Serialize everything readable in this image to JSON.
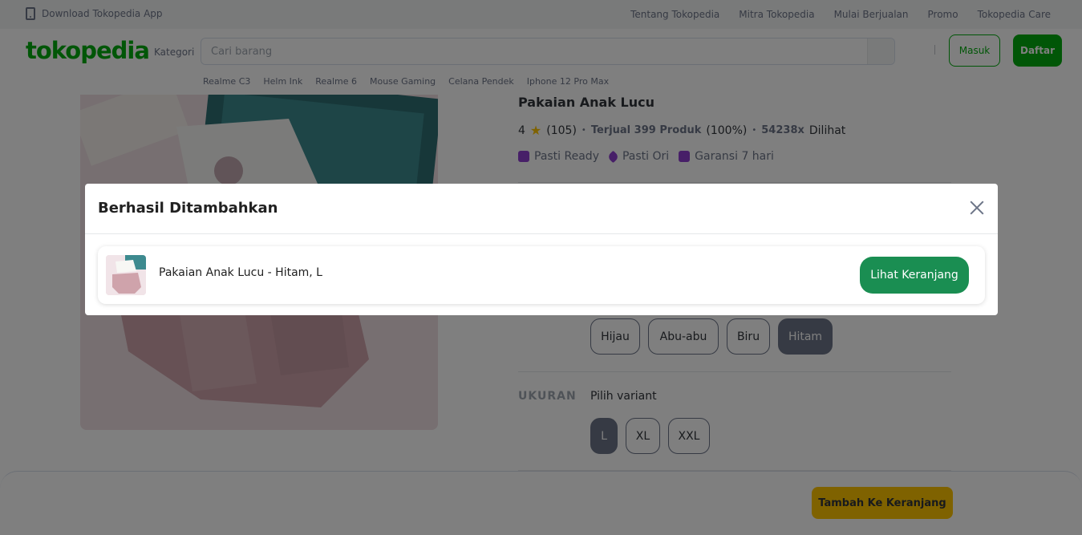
{
  "topbar": {
    "app_link": "Download Tokopedia App",
    "links": [
      "Tentang Tokopedia",
      "Mitra Tokopedia",
      "Mulai Berjualan",
      "Promo",
      "Tokopedia Care"
    ]
  },
  "header": {
    "logo": "tokopedia",
    "kategori": "Kategori",
    "search_placeholder": "Cari barang",
    "login_label": "Masuk",
    "register_label": "Daftar",
    "suggestions": [
      "Realme C3",
      "Helm Ink",
      "Realme 6",
      "Mouse Gaming",
      "Celana Pendek",
      "Iphone 12 Pro Max"
    ]
  },
  "product": {
    "title": "Pakaian Anak Lucu",
    "rating": "4",
    "reviews": "(105)",
    "sold": "Terjual 399 Produk",
    "sold_pct": "(100%)",
    "views_count": "54238x",
    "views_label": "Dilihat",
    "badges": [
      "Pasti Ready",
      "Pasti Ori",
      "Garansi 7 hari"
    ],
    "colors": [
      "Hijau",
      "Abu-abu",
      "Biru",
      "Hitam"
    ],
    "selected_color": "Hitam",
    "size_label": "UKURAN",
    "size_prompt": "Pilih variant",
    "sizes": [
      "L",
      "XL",
      "XXL"
    ],
    "selected_size": "L",
    "add_to_cart": "Tambah Ke Keranjang"
  },
  "modal": {
    "title": "Berhasil Ditambahkan",
    "item_name": "Pakaian Anak Lucu - Hitam, L",
    "view_cart": "Lihat Keranjang"
  },
  "colors": {
    "brand_green": "#03ac0e",
    "cart_button": "#1a8e52",
    "add_button": "#ffc400"
  }
}
